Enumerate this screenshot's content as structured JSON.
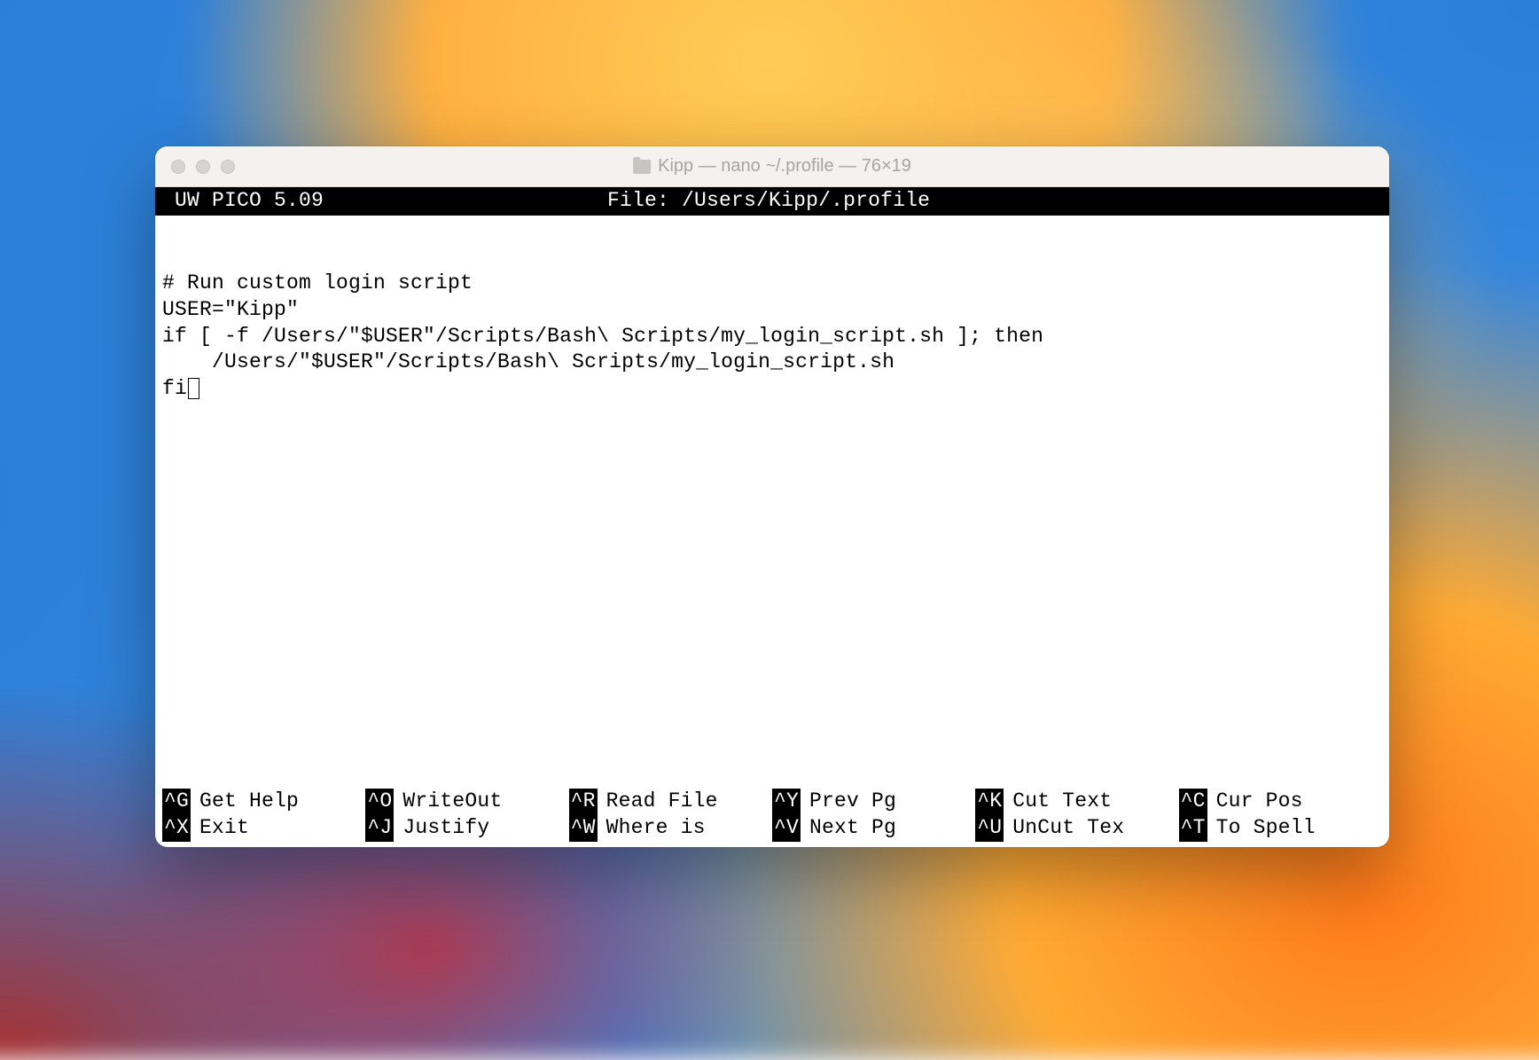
{
  "window": {
    "title": "Kipp — nano ~/.profile — 76×19"
  },
  "editor": {
    "app_name": " UW PICO 5.09",
    "file_label": "File: /Users/Kipp/.profile",
    "lines": [
      "# Run custom login script",
      "USER=\"Kipp\"",
      "",
      "if [ -f /Users/\"$USER\"/Scripts/Bash\\ Scripts/my_login_script.sh ]; then",
      "    /Users/\"$USER\"/Scripts/Bash\\ Scripts/my_login_script.sh",
      "fi"
    ]
  },
  "shortcuts": {
    "row1": [
      {
        "key": "^G",
        "label": "Get Help"
      },
      {
        "key": "^O",
        "label": "WriteOut"
      },
      {
        "key": "^R",
        "label": "Read File"
      },
      {
        "key": "^Y",
        "label": "Prev Pg"
      },
      {
        "key": "^K",
        "label": "Cut Text"
      },
      {
        "key": "^C",
        "label": "Cur Pos"
      }
    ],
    "row2": [
      {
        "key": "^X",
        "label": "Exit"
      },
      {
        "key": "^J",
        "label": "Justify"
      },
      {
        "key": "^W",
        "label": "Where is"
      },
      {
        "key": "^V",
        "label": "Next Pg"
      },
      {
        "key": "^U",
        "label": "UnCut Tex"
      },
      {
        "key": "^T",
        "label": "To Spell"
      }
    ]
  }
}
